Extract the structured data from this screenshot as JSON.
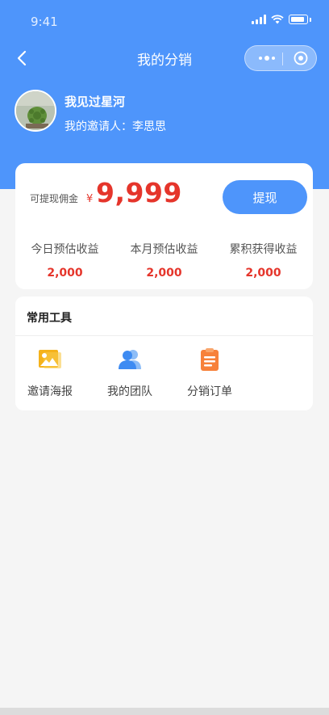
{
  "status": {
    "time": "9:41",
    "signal_icon": "signal-icon",
    "wifi_icon": "wifi-icon",
    "battery_icon": "battery-icon"
  },
  "nav": {
    "title": "我的分销",
    "back_icon": "back-arrow-icon",
    "more_icon": "more-dots-icon",
    "close_icon": "target-circle-icon"
  },
  "user": {
    "name": "我见过星河",
    "inviter": "我的邀请人：李思思"
  },
  "wallet": {
    "label": "可提现佣金",
    "currency": "¥",
    "amount": "9,999",
    "button": "提现",
    "stats": [
      {
        "label": "今日预估收益",
        "value": "2,000"
      },
      {
        "label": "本月预估收益",
        "value": "2,000"
      },
      {
        "label": "累积获得收益",
        "value": "2,000"
      }
    ]
  },
  "tools": {
    "title": "常用工具",
    "items": [
      {
        "label": "邀请海报",
        "icon": "poster-image-icon",
        "color": "#f5b21b"
      },
      {
        "label": "我的团队",
        "icon": "team-users-icon",
        "color": "#3d8bf2"
      },
      {
        "label": "分销订单",
        "icon": "order-clipboard-icon",
        "color": "#f7813a"
      }
    ]
  },
  "colors": {
    "primary": "#4e95fb",
    "accent": "#e5352b",
    "background": "#f5f5f5"
  }
}
